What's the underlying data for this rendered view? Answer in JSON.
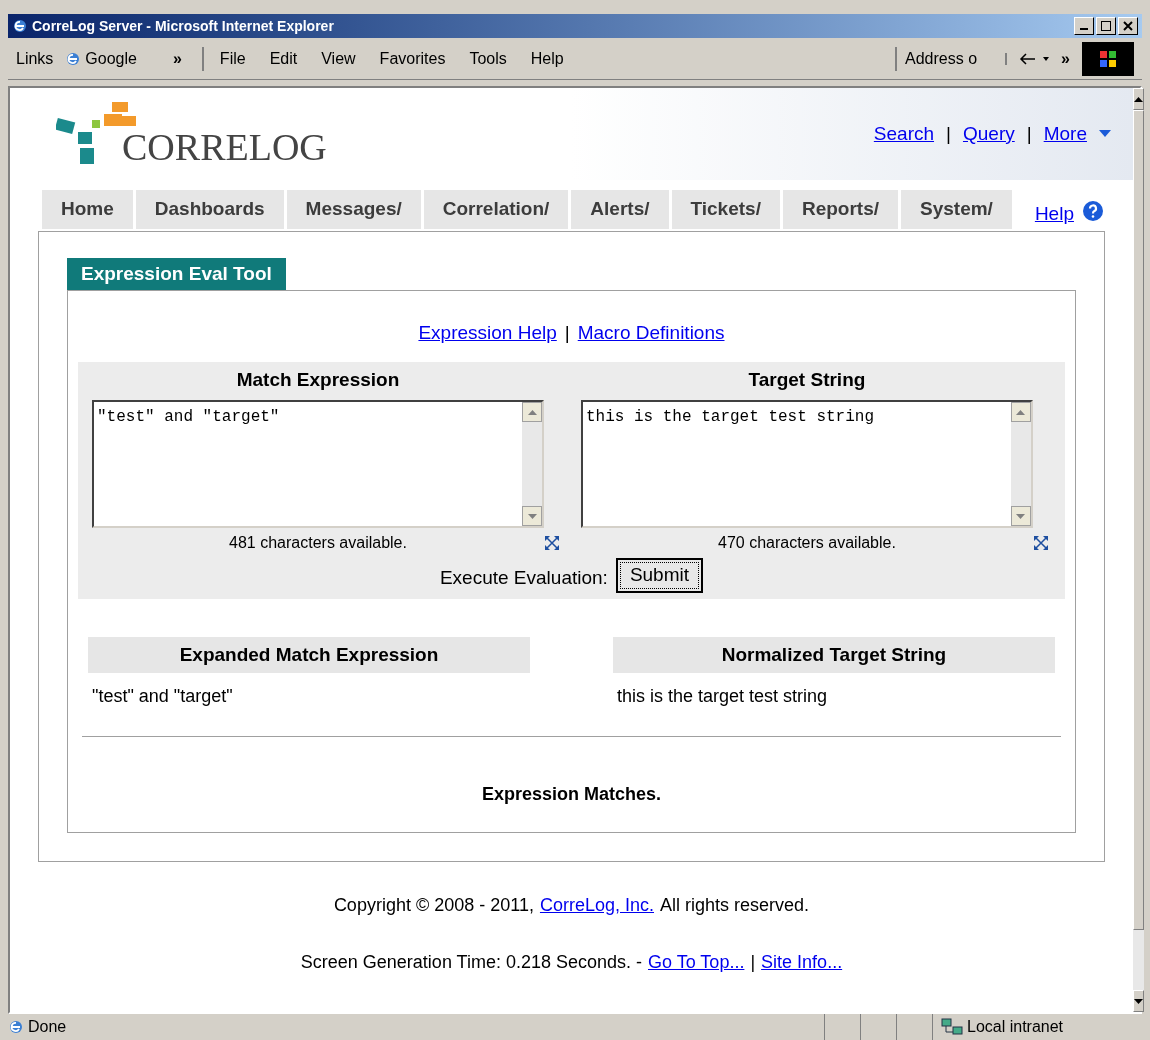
{
  "window": {
    "title": "CorreLog Server - Microsoft Internet Explorer"
  },
  "toolbar": {
    "links_label": "Links",
    "google": "Google",
    "chevron": "»",
    "menu": [
      "File",
      "Edit",
      "View",
      "Favorites",
      "Tools",
      "Help"
    ],
    "address_label": "Address o",
    "chevron2": "»"
  },
  "header": {
    "logo": "CORRELOG",
    "links": [
      "Search",
      "Query",
      "More"
    ],
    "separator": "|"
  },
  "nav": {
    "tabs": [
      "Home",
      "Dashboards",
      "Messages/",
      "Correlation/",
      "Alerts/",
      "Tickets/",
      "Reports/",
      "System/"
    ],
    "help": "Help"
  },
  "panel": {
    "title": "Expression Eval Tool",
    "help_links": [
      "Expression Help",
      "Macro Definitions"
    ],
    "separator": "|",
    "fields": [
      {
        "label": "Match Expression",
        "value": "\"test\" and \"target\"",
        "count": "481 characters available."
      },
      {
        "label": "Target String",
        "value": "this is the target test string",
        "count": "470 characters available."
      }
    ],
    "execute_label": "Execute Evaluation:",
    "submit": "Submit",
    "results": [
      {
        "label": "Expanded Match Expression",
        "value": "\"test\" and \"target\""
      },
      {
        "label": "Normalized Target String",
        "value": "this is the target test string"
      }
    ],
    "outcome": "Expression Matches."
  },
  "footer": {
    "copyright": "Copyright © 2008 - 2011,",
    "company_link": "CorreLog, Inc.",
    "rights": "All rights reserved.",
    "generation": "Screen Generation Time: 0.218 Seconds. -",
    "links": [
      "Go To Top...",
      "Site Info..."
    ],
    "separator": "|"
  },
  "status_bar": {
    "text": "Done",
    "zone": "Local intranet"
  }
}
